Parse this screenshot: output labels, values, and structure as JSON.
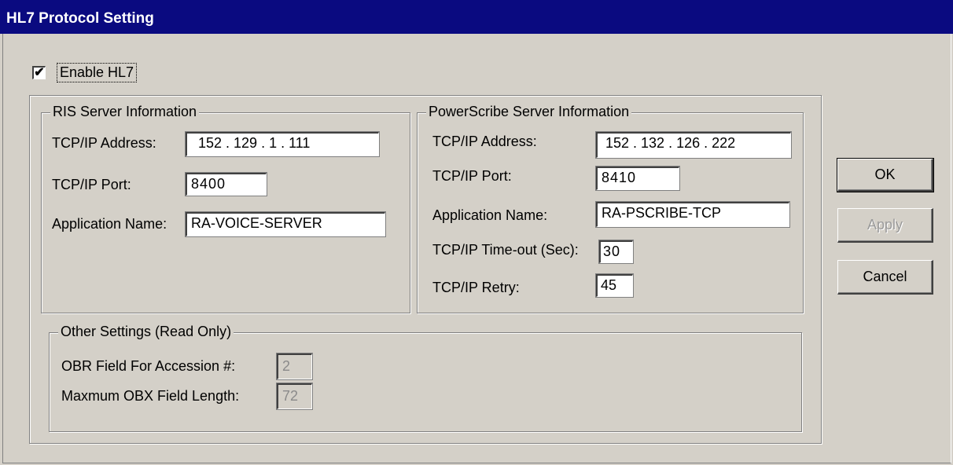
{
  "window": {
    "title": "HL7 Protocol Setting"
  },
  "enable": {
    "label": "Enable HL7",
    "checked": true,
    "check_glyph": "✔"
  },
  "ris": {
    "legend": "RIS Server Information",
    "ip_label": "TCP/IP Address:",
    "ip_value": "152 . 129 .   1   . 111",
    "port_label": "TCP/IP Port:",
    "port_value": "8400",
    "app_label": "Application Name:",
    "app_value": "RA-VOICE-SERVER"
  },
  "powerscribe": {
    "legend": "PowerScribe Server Information",
    "ip_label": "TCP/IP Address:",
    "ip_value": "152 . 132 . 126 . 222",
    "port_label": "TCP/IP Port:",
    "port_value": "8410",
    "app_label": "Application Name:",
    "app_value": "RA-PSCRIBE-TCP",
    "timeout_label": "TCP/IP Time-out (Sec):",
    "timeout_value": "30",
    "retry_label": "TCP/IP Retry:",
    "retry_value": "45"
  },
  "other": {
    "legend": "Other Settings (Read Only)",
    "obr_label": "OBR Field For Accession #:",
    "obr_value": "2",
    "obx_label": "Maxmum OBX Field Length:",
    "obx_value": "72"
  },
  "buttons": {
    "ok": "OK",
    "apply": "Apply",
    "cancel": "Cancel"
  }
}
